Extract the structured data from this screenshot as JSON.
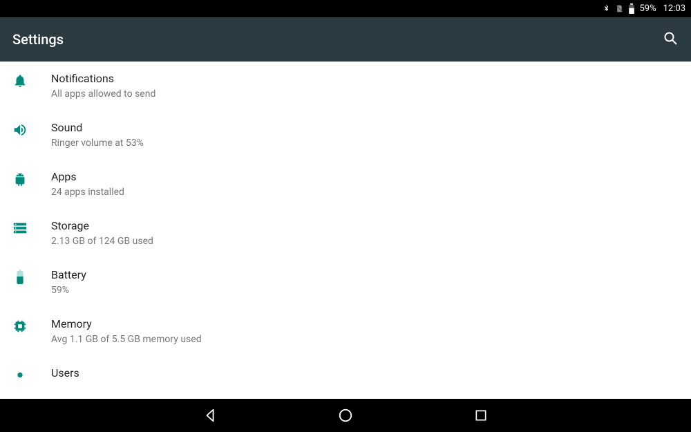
{
  "status": {
    "battery_text": "59%",
    "time": "12:03"
  },
  "header": {
    "title": "Settings"
  },
  "items": [
    {
      "title": "Notifications",
      "sub": "All apps allowed to send"
    },
    {
      "title": "Sound",
      "sub": "Ringer volume at 53%"
    },
    {
      "title": "Apps",
      "sub": "24 apps installed"
    },
    {
      "title": "Storage",
      "sub": "2.13 GB of 124 GB used"
    },
    {
      "title": "Battery",
      "sub": "59%"
    },
    {
      "title": "Memory",
      "sub": "Avg 1.1 GB of 5.5 GB memory used"
    },
    {
      "title": "Users",
      "sub": ""
    }
  ],
  "colors": {
    "accent": "#00897b",
    "action_bar": "#2b3940"
  }
}
